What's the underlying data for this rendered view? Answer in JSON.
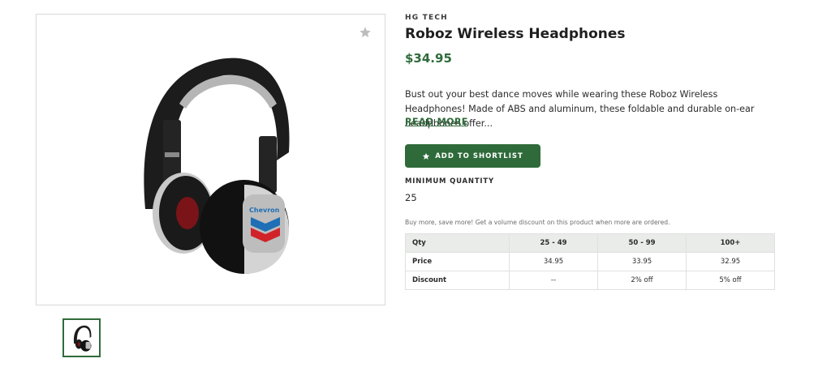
{
  "product": {
    "brand": "HG TECH",
    "title": "Roboz Wireless Headphones",
    "price": "$34.95",
    "description": "Bust out your best dance moves while wearing these Roboz Wireless Headphones! Made of ABS and aluminum, these foldable and durable on-ear headphones offer...",
    "read_more_label": "READ MORE",
    "logo_text": "Chevron"
  },
  "actions": {
    "shortlist_label": "ADD TO SHORTLIST",
    "favorite_icon": "star-icon"
  },
  "minimum_quantity": {
    "label": "MINIMUM QUANTITY",
    "value": "25"
  },
  "volume_discount": {
    "note": "Buy more, save more! Get a volume discount on this product when more are ordered.",
    "header": [
      "Qty",
      "25 - 49",
      "50 - 99",
      "100+"
    ],
    "rows": [
      [
        "Price",
        "34.95",
        "33.95",
        "32.95"
      ],
      [
        "Discount",
        "--",
        "2% off",
        "5% off"
      ]
    ]
  },
  "colors": {
    "accent": "#2f6b3a",
    "table_header_bg": "#e9ece9"
  }
}
